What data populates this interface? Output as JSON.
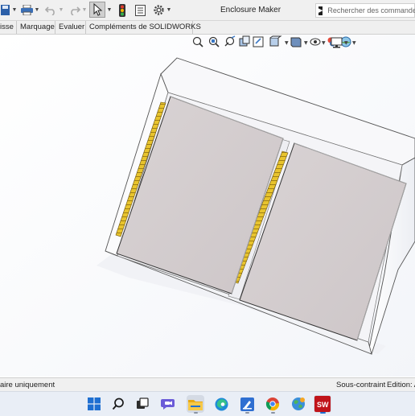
{
  "window": {
    "title": "Enclosure Maker"
  },
  "toolbar": {
    "search_placeholder": "Rechercher des commandes",
    "icons": [
      "save-icon",
      "print-icon",
      "undo-icon",
      "redo-icon",
      "select-pointer-icon",
      "rebuild-traffic-light-icon",
      "file-properties-icon",
      "options-gear-icon"
    ]
  },
  "tabs": [
    {
      "label": "isse"
    },
    {
      "label": "Marquage"
    },
    {
      "label": "Evaluer"
    },
    {
      "label": "Compléments de SOLIDWORKS"
    }
  ],
  "heads_up_toolbar": {
    "icons": [
      "zoom-to-fit-icon",
      "zoom-to-area-icon",
      "previous-view-icon",
      "section-view-icon",
      "dynamic-annotation-icon",
      "view-orientation-icon",
      "display-style-icon",
      "hide-show-items-icon",
      "edit-appearance-icon",
      "apply-scene-icon",
      "view-settings-icon"
    ]
  },
  "status": {
    "left": "aire uniquement",
    "constraint": "Sous-contraint",
    "edition": "Edition: A"
  },
  "taskbar": {
    "icons": [
      "windows-start-icon",
      "search-icon",
      "task-view-icon",
      "teams-chat-icon",
      "file-explorer-icon",
      "edge-browser-icon",
      "text-editor-icon",
      "chrome-icon",
      "globe-app-icon",
      "solidworks-icon"
    ],
    "solidworks_label": "SW"
  },
  "colors": {
    "panel_fill": "#d8d2d2",
    "hinge_yellow": "#e8c42e",
    "enclosure_white": "#f6f6f8",
    "accent_red": "#c0141b"
  }
}
